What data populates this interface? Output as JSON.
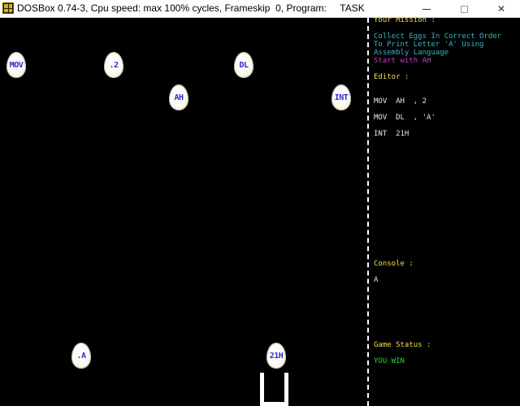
{
  "window": {
    "title": "DOSBox 0.74-3, Cpu speed: max 100% cycles, Frameskip  0, Program:     TASK",
    "min_glyph": "—",
    "max_glyph": "☐",
    "close_glyph": "✕"
  },
  "eggs": [
    {
      "label": "MOV"
    },
    {
      "label": ".2"
    },
    {
      "label": "DL"
    },
    {
      "label": "AH"
    },
    {
      "label": "INT"
    },
    {
      "label": ".A"
    },
    {
      "label": "21H"
    }
  ],
  "panel": {
    "mission_heading": "Your Mission :",
    "mission_lines": [
      "Collect Eggs In Correct Order",
      "To Print Letter 'A' Using",
      "Assembly Language"
    ],
    "mission_hint": "Start with AH",
    "editor_heading": "Editor :",
    "editor_lines": [
      "MOV  AH  , 2",
      "MOV  DL  , 'A'",
      "INT  21H"
    ],
    "console_heading": "Console :",
    "console_output": "A",
    "status_heading": "Game Status :",
    "status_text": "YOU WIN"
  },
  "colors": {
    "background": "#000000",
    "heading": "#f0e044",
    "mission_text": "#36b6c6",
    "hint": "#c041c8",
    "code": "#e8e8e8",
    "win": "#2dd43a",
    "egg_label": "#2b2bd6"
  }
}
